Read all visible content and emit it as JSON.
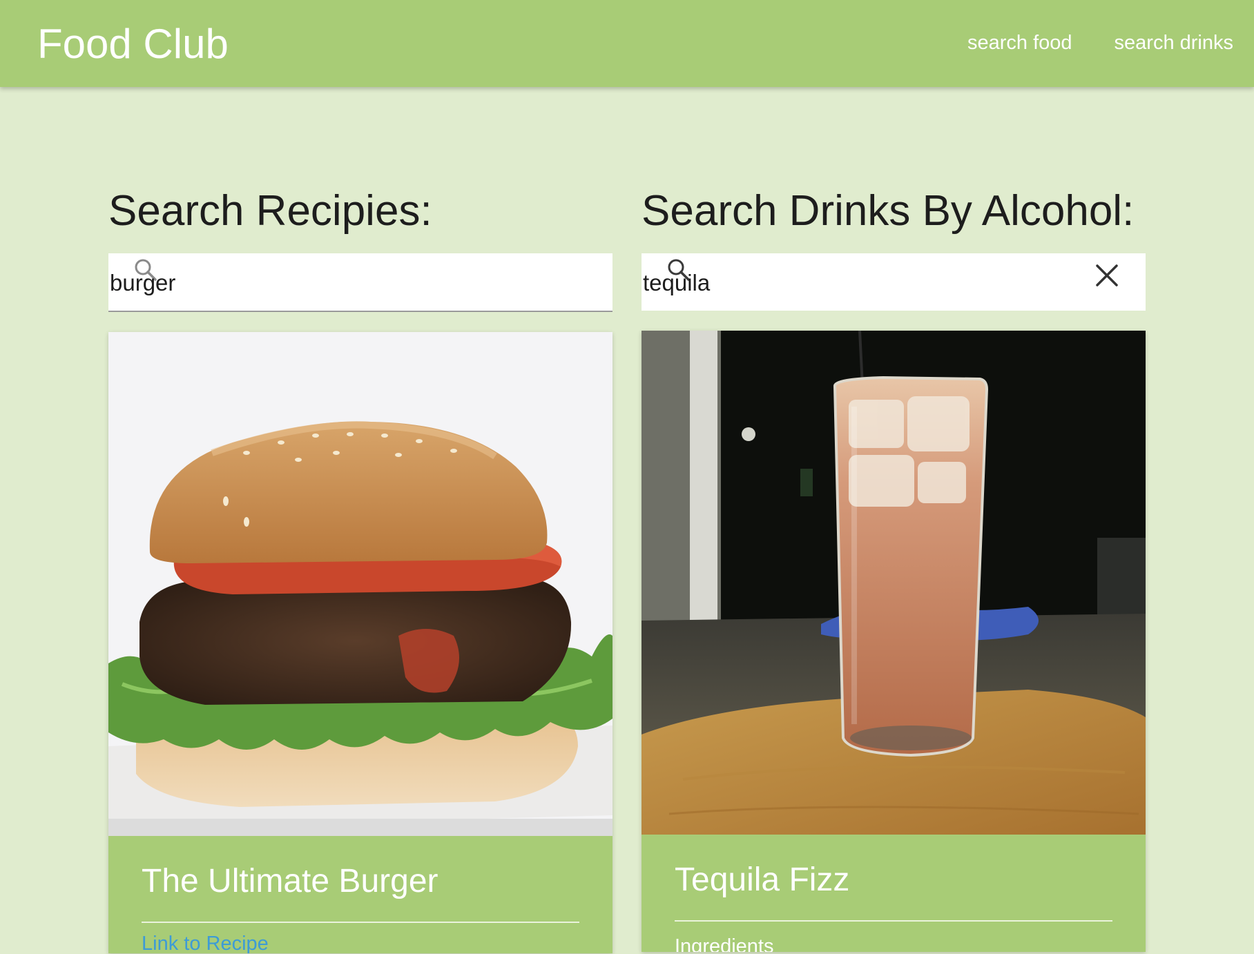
{
  "navbar": {
    "brand": "Food Club",
    "links": [
      "search food",
      "search drinks"
    ]
  },
  "recipes": {
    "heading": "Search Recipies:",
    "search_value": "burger",
    "card": {
      "title": "The Ultimate Burger",
      "link_label": "Link to Recipe"
    }
  },
  "drinks": {
    "heading": "Search Drinks By Alcohol:",
    "search_value": "tequila",
    "card": {
      "title": "Tequila Fizz",
      "section_label": "Ingredients"
    }
  },
  "icons": {
    "search": "search-icon",
    "clear": "close-icon"
  },
  "colors": {
    "navbar": "#a8cc76",
    "page_background": "#e0ecce",
    "link": "#3d9bd6"
  }
}
